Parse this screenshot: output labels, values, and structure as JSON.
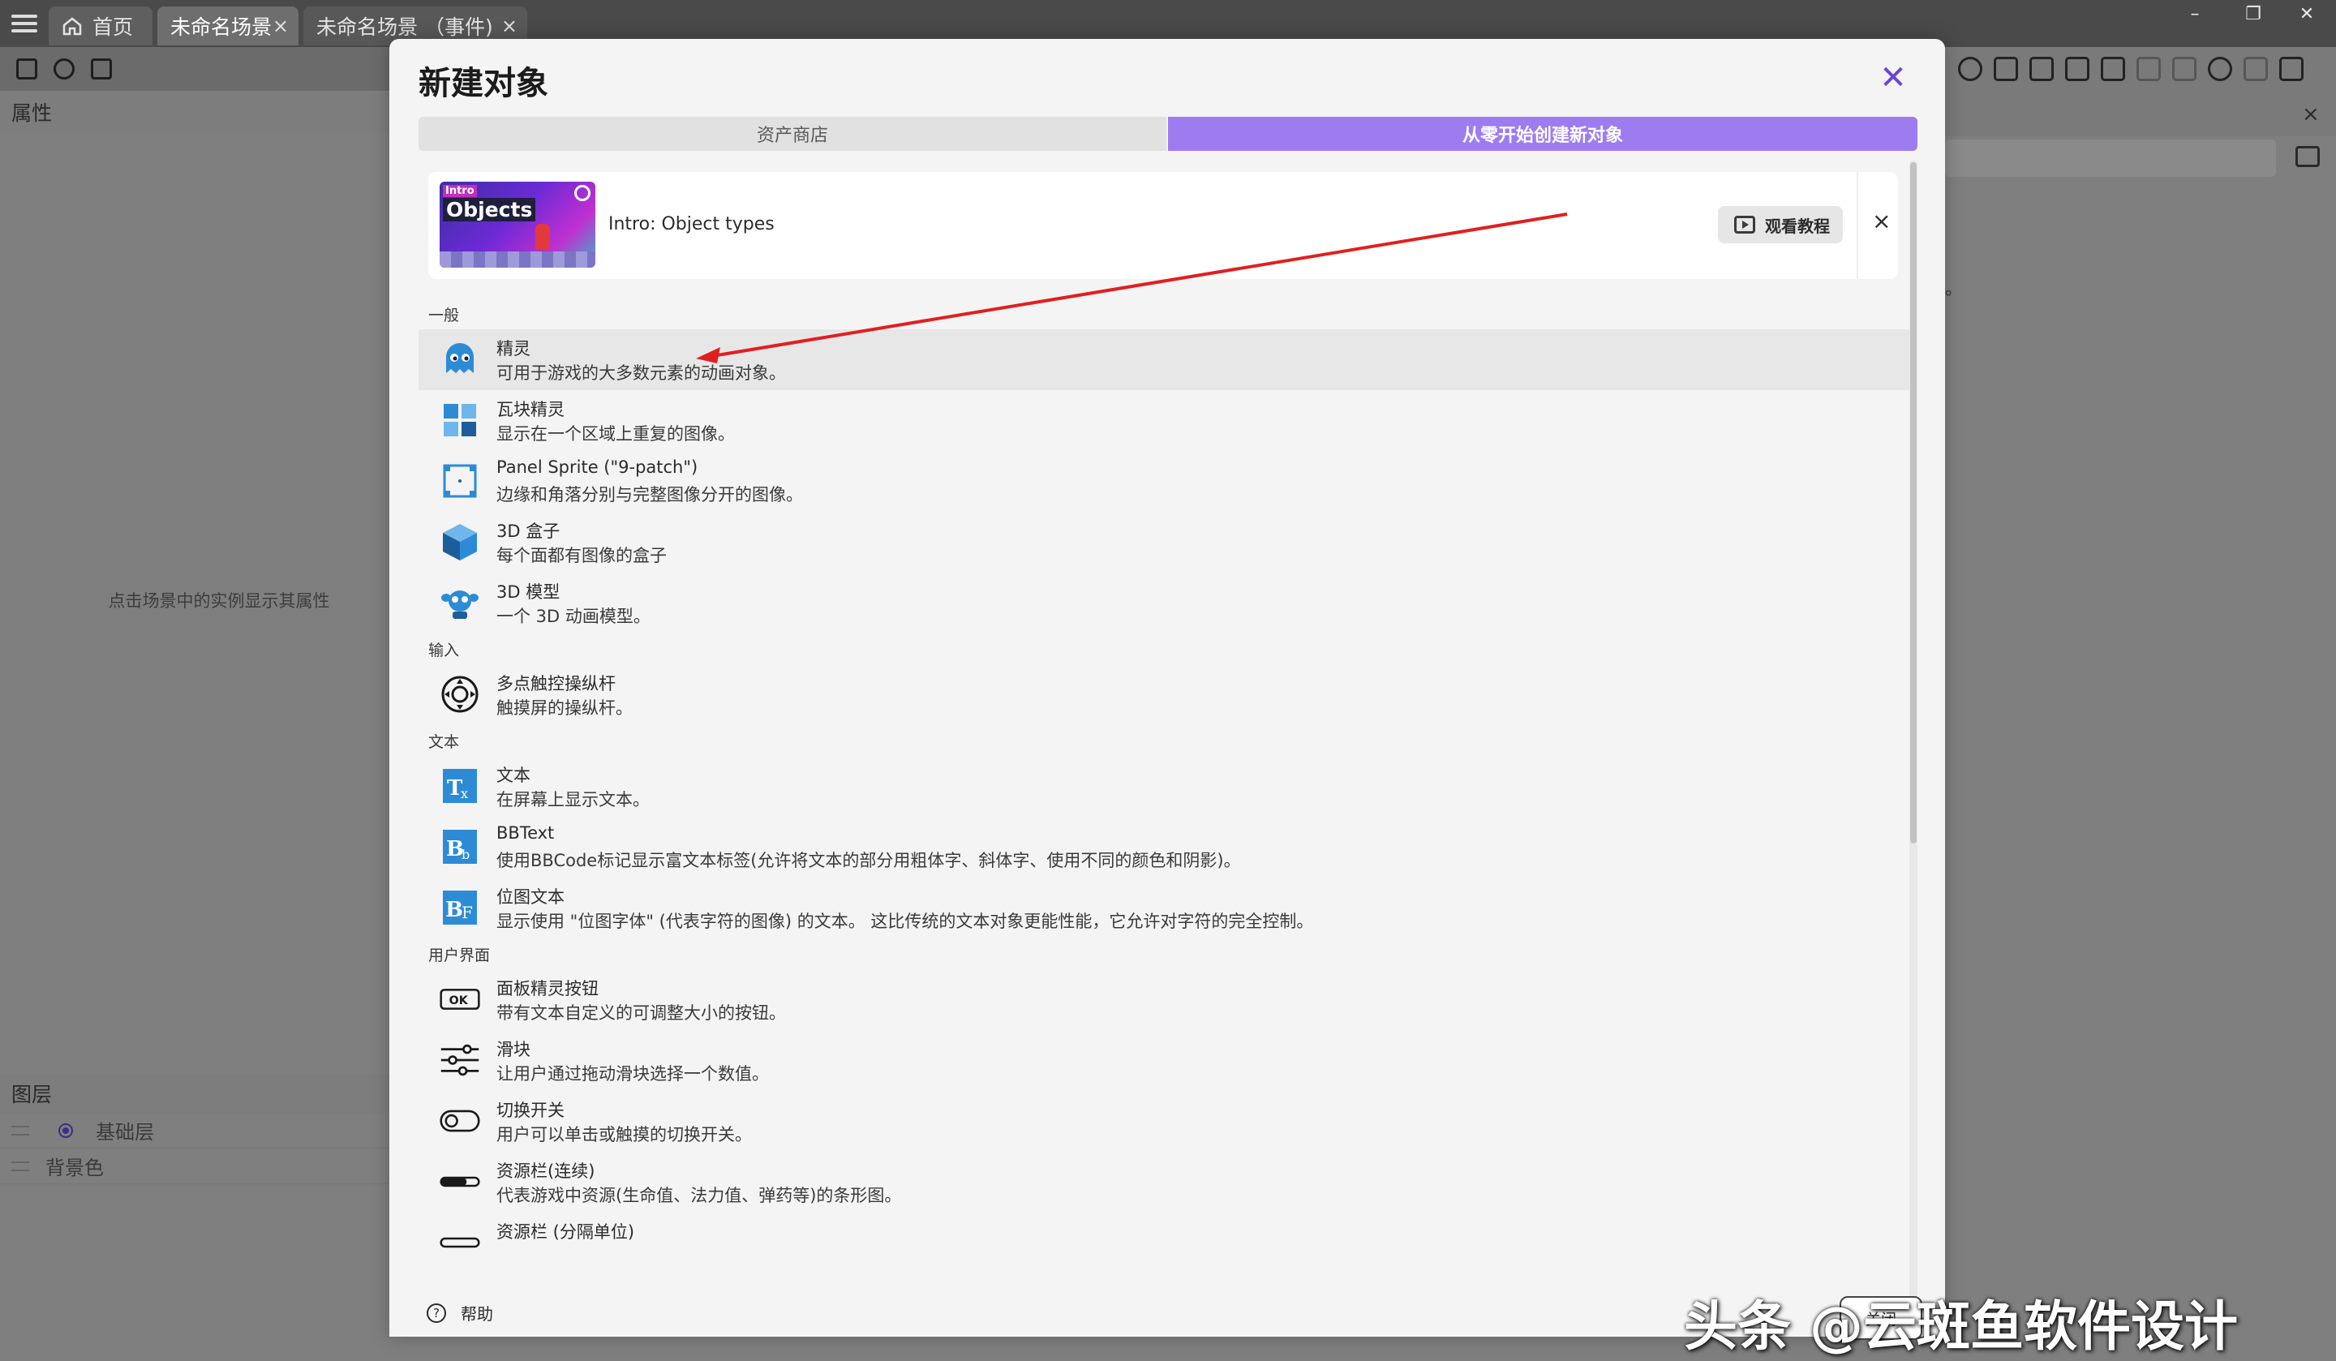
{
  "tabs": [
    {
      "label": "首页"
    },
    {
      "label": "未命名场景",
      "close": "×"
    },
    {
      "label": "未命名场景 （事件)",
      "close": "×"
    }
  ],
  "window_controls": {
    "minimize": "–",
    "restore": "❐",
    "close": "✕"
  },
  "left_panel": {
    "properties_title": "属性",
    "properties_hint": "点击场景中的实例显示其属性",
    "layers_title": "图层",
    "layers": [
      {
        "label": "基础层"
      },
      {
        "label": "背景色"
      }
    ]
  },
  "right_panel": {
    "close": "×",
    "fragment": "。"
  },
  "dialog": {
    "title": "新建对象",
    "close": "✕",
    "tabs": {
      "store": "资产商店",
      "new": "从零开始创建新对象"
    },
    "tutorial": {
      "thumb_small": "Intro",
      "thumb_big": "Objects",
      "title": "Intro: Object types",
      "watch_label": "观看教程",
      "close": "×"
    },
    "sections": [
      {
        "title": "一般",
        "items": [
          {
            "title": "精灵",
            "desc": "可用于游戏的大多数元素的动画对象。",
            "icon": "sprite-ghost-icon"
          },
          {
            "title": "瓦块精灵",
            "desc": "显示在一个区域上重复的图像。",
            "icon": "tiled-sprite-icon"
          },
          {
            "title": "Panel Sprite (\"9-patch\")",
            "desc": "边缘和角落分别与完整图像分开的图像。",
            "icon": "panel-sprite-icon"
          },
          {
            "title": "3D 盒子",
            "desc": "每个面都有图像的盒子",
            "icon": "cube-3d-icon"
          },
          {
            "title": "3D 模型",
            "desc": "一个 3D 动画模型。",
            "icon": "model-3d-icon"
          }
        ]
      },
      {
        "title": "输入",
        "items": [
          {
            "title": "多点触控操纵杆",
            "desc": "触摸屏的操纵杆。",
            "icon": "joystick-icon"
          }
        ]
      },
      {
        "title": "文本",
        "items": [
          {
            "title": "文本",
            "desc": "在屏幕上显示文本。",
            "icon": "text-object-icon"
          },
          {
            "title": "BBText",
            "desc": "使用BBCode标记显示富文本标签(允许将文本的部分用粗体字、斜体字、使用不同的颜色和阴影)。",
            "icon": "bbtext-icon"
          },
          {
            "title": "位图文本",
            "desc": "显示使用 \"位图字体\" (代表字符的图像) 的文本。 这比传统的文本对象更能性能，它允许对字符的完全控制。",
            "icon": "bitmap-text-icon"
          }
        ]
      },
      {
        "title": "用户界面",
        "items": [
          {
            "title": "面板精灵按钮",
            "desc": "带有文本自定义的可调整大小的按钮。",
            "icon": "button-ok-icon"
          },
          {
            "title": "滑块",
            "desc": "让用户通过拖动滑块选择一个数值。",
            "icon": "slider-icon"
          },
          {
            "title": "切换开关",
            "desc": "用户可以单击或触摸的切换开关。",
            "icon": "toggle-switch-icon"
          },
          {
            "title": "资源栏(连续)",
            "desc": "代表游戏中资源(生命值、法力值、弹药等)的条形图。",
            "icon": "resource-bar-icon"
          },
          {
            "title": "资源栏 (分隔单位)",
            "desc": "",
            "icon": "resource-bar-units-icon"
          }
        ]
      }
    ],
    "help_label": "帮助",
    "close_button": "关闭"
  },
  "watermark": "头条 @云斑鱼软件设计",
  "colors": {
    "accent": "#9d7cf0",
    "accent_dark": "#6c44d6",
    "annotation_arrow": "#e02020",
    "icon_blue": "#2d8bd6"
  }
}
